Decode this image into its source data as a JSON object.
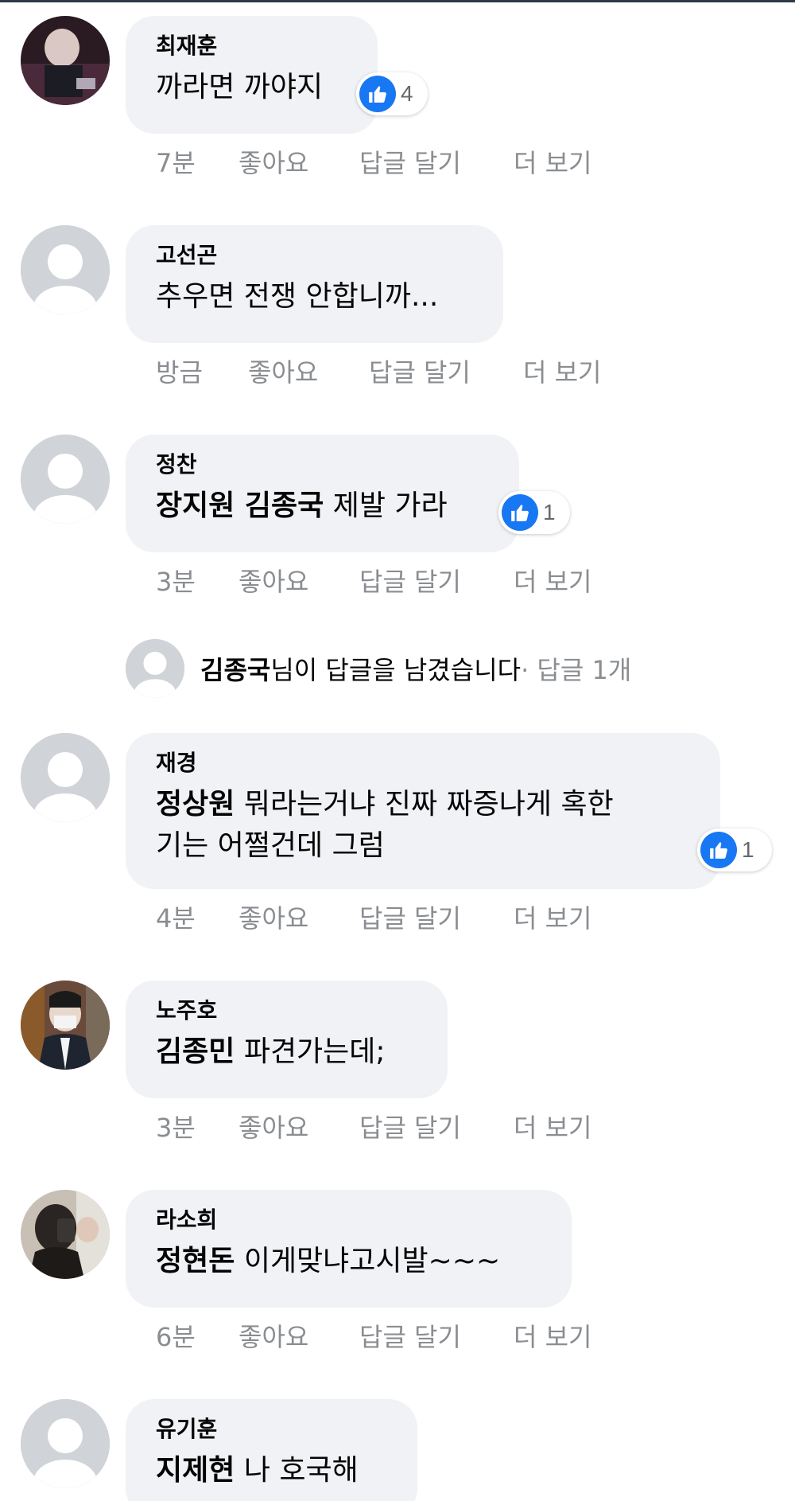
{
  "comments": [
    {
      "author": "최재훈",
      "text": "까라면 까야지",
      "mention": "",
      "likes": "4",
      "time": "7분",
      "like_label": "좋아요",
      "reply_label": "답글 달기",
      "more_label": "더 보기",
      "avatar": "photo"
    },
    {
      "author": "고선곤",
      "text": "추우면 전쟁 안합니까...",
      "mention": "",
      "likes": "",
      "time": "방금",
      "like_label": "좋아요",
      "reply_label": "답글 달기",
      "more_label": "더 보기",
      "avatar": "default"
    },
    {
      "author": "정찬",
      "mention": "장지원 김종국",
      "text": " 제발 가라",
      "likes": "1",
      "time": "3분",
      "like_label": "좋아요",
      "reply_label": "답글 달기",
      "more_label": "더 보기",
      "avatar": "default"
    },
    {
      "author": "재경",
      "mention": "정상원",
      "text": " 뭐라는거냐 진짜 짜증나게 혹한",
      "text_line2": "기는 어쩔건데 그럼",
      "likes": "1",
      "time": "4분",
      "like_label": "좋아요",
      "reply_label": "답글 달기",
      "more_label": "더 보기",
      "avatar": "default"
    },
    {
      "author": "노주호",
      "mention": "김종민",
      "text": " 파견가는데;",
      "likes": "",
      "time": "3분",
      "like_label": "좋아요",
      "reply_label": "답글 달기",
      "more_label": "더 보기",
      "avatar": "photo"
    },
    {
      "author": "라소희",
      "mention": "정현돈",
      "text": " 이게맞냐고시발~~~",
      "likes": "",
      "time": "6분",
      "like_label": "좋아요",
      "reply_label": "답글 달기",
      "more_label": "더 보기",
      "avatar": "photo"
    },
    {
      "author": "유기훈",
      "mention": "지제현",
      "text": " 나 호국해",
      "likes": "",
      "avatar": "default"
    }
  ],
  "reply_summary": {
    "who": "김종국",
    "message": "님이 답글을 남겼습니다",
    "count": " · 답글 1개"
  },
  "icons": {
    "like": "thumbs-up-icon",
    "avatar_default": "default-profile-icon"
  },
  "colors": {
    "like_blue": "#1877f2",
    "bubble_bg": "#f0f2f5",
    "meta_gray": "#8a8d91"
  }
}
